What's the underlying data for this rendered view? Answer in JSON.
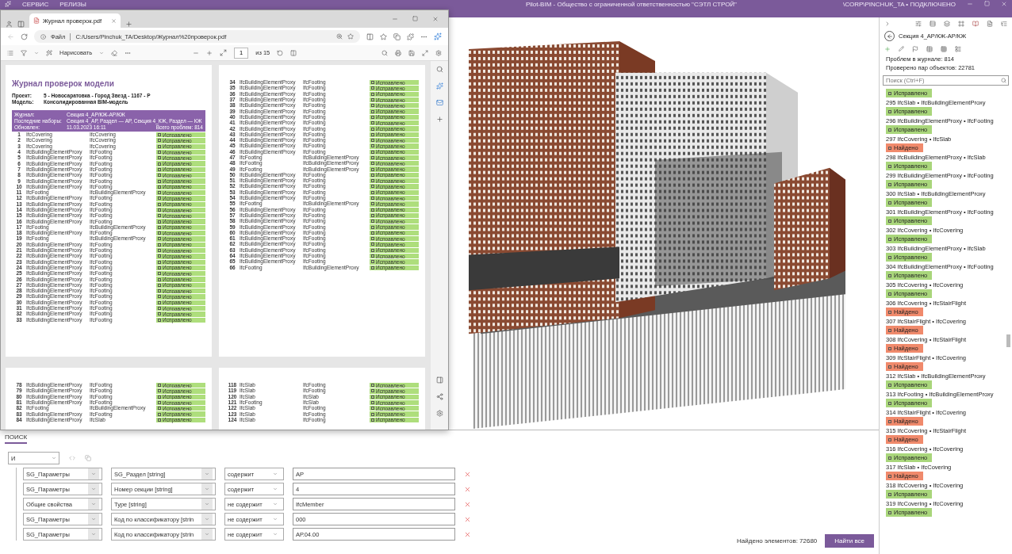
{
  "app": {
    "menu": [
      "СЕРВИС",
      "РЕЛИЗЫ"
    ],
    "title": "Pilot-BIM - Общество с ограниченной ответственностью \"СЭТЛ СТРОЙ\"",
    "user": "\\CORP\\PINCHUK_TA • ПОДКЛЮЧЕНО"
  },
  "browser": {
    "tab": {
      "title": "Журнал проверок.pdf",
      "selected": true
    },
    "address": {
      "scheme": "Файл",
      "url": "C:/Users/Pinchuk_TA/Desktop/Журнал%20проверок.pdf"
    },
    "toolbar": {
      "draw": "Нарисовать",
      "page": "1",
      "page_count": "из 15"
    },
    "pages": [
      {
        "header": {
          "title": "Журнал проверок модели",
          "meta": [
            [
              "Проект:",
              "5 - Новосаратовка - Город Звезд - 1167 - Р"
            ],
            [
              "Модель:",
              "Консолидированная BIM-модель"
            ]
          ],
          "journal": [
            [
              "Журнал:",
              "Секция 4_АР/КЖ-АР/КЖ"
            ],
            [
              "Последние наборы:",
              "Секция 4_АР, Раздел — АР, Секция 4_КЖ, Раздел — КЖ"
            ],
            [
              "Обновлен:",
              "11.03.2023 16:11",
              "Всего проблем: 814"
            ]
          ]
        },
        "rows": [
          [
            "1",
            "IfcCovering",
            "IfcCovering",
            "Исправлено"
          ],
          [
            "2",
            "IfcCovering",
            "IfcCovering",
            "Исправлено"
          ],
          [
            "3",
            "IfcCovering",
            "IfcCovering",
            "Исправлено"
          ],
          [
            "4",
            "IfcBuildingElementProxy",
            "IfcFooting",
            "Исправлено"
          ],
          [
            "5",
            "IfcBuildingElementProxy",
            "IfcFooting",
            "Исправлено"
          ],
          [
            "6",
            "IfcBuildingElementProxy",
            "IfcFooting",
            "Исправлено"
          ],
          [
            "7",
            "IfcBuildingElementProxy",
            "IfcFooting",
            "Исправлено"
          ],
          [
            "8",
            "IfcBuildingElementProxy",
            "IfcFooting",
            "Исправлено"
          ],
          [
            "9",
            "IfcBuildingElementProxy",
            "IfcFooting",
            "Исправлено"
          ],
          [
            "10",
            "IfcBuildingElementProxy",
            "IfcFooting",
            "Исправлено"
          ],
          [
            "11",
            "IfcFooting",
            "IfcBuildingElementProxy",
            "Исправлено"
          ],
          [
            "12",
            "IfcBuildingElementProxy",
            "IfcFooting",
            "Исправлено"
          ],
          [
            "13",
            "IfcBuildingElementProxy",
            "IfcFooting",
            "Исправлено"
          ],
          [
            "14",
            "IfcBuildingElementProxy",
            "IfcFooting",
            "Исправлено"
          ],
          [
            "15",
            "IfcBuildingElementProxy",
            "IfcFooting",
            "Исправлено"
          ],
          [
            "16",
            "IfcBuildingElementProxy",
            "IfcFooting",
            "Исправлено"
          ],
          [
            "17",
            "IfcFooting",
            "IfcBuildingElementProxy",
            "Исправлено"
          ],
          [
            "18",
            "IfcBuildingElementProxy",
            "IfcFooting",
            "Исправлено"
          ],
          [
            "19",
            "IfcFooting",
            "IfcBuildingElementProxy",
            "Исправлено"
          ],
          [
            "20",
            "IfcBuildingElementProxy",
            "IfcFooting",
            "Исправлено"
          ],
          [
            "21",
            "IfcBuildingElementProxy",
            "IfcFooting",
            "Исправлено"
          ],
          [
            "22",
            "IfcBuildingElementProxy",
            "IfcFooting",
            "Исправлено"
          ],
          [
            "23",
            "IfcBuildingElementProxy",
            "IfcFooting",
            "Исправлено"
          ],
          [
            "24",
            "IfcBuildingElementProxy",
            "IfcFooting",
            "Исправлено"
          ],
          [
            "25",
            "IfcBuildingElementProxy",
            "IfcFooting",
            "Исправлено"
          ],
          [
            "26",
            "IfcBuildingElementProxy",
            "IfcFooting",
            "Исправлено"
          ],
          [
            "27",
            "IfcBuildingElementProxy",
            "IfcFooting",
            "Исправлено"
          ],
          [
            "28",
            "IfcBuildingElementProxy",
            "IfcFooting",
            "Исправлено"
          ],
          [
            "29",
            "IfcBuildingElementProxy",
            "IfcFooting",
            "Исправлено"
          ],
          [
            "30",
            "IfcBuildingElementProxy",
            "IfcFooting",
            "Исправлено"
          ],
          [
            "31",
            "IfcBuildingElementProxy",
            "IfcFooting",
            "Исправлено"
          ],
          [
            "32",
            "IfcBuildingElementProxy",
            "IfcFooting",
            "Исправлено"
          ],
          [
            "33",
            "IfcBuildingElementProxy",
            "IfcFooting",
            "Исправлено"
          ]
        ]
      },
      {
        "rows": [
          [
            "34",
            "IfcBuildingElementProxy",
            "IfcFooting",
            "Исправлено"
          ],
          [
            "35",
            "IfcBuildingElementProxy",
            "IfcFooting",
            "Исправлено"
          ],
          [
            "36",
            "IfcBuildingElementProxy",
            "IfcFooting",
            "Исправлено"
          ],
          [
            "37",
            "IfcBuildingElementProxy",
            "IfcFooting",
            "Исправлено"
          ],
          [
            "38",
            "IfcBuildingElementProxy",
            "IfcFooting",
            "Исправлено"
          ],
          [
            "39",
            "IfcBuildingElementProxy",
            "IfcFooting",
            "Исправлено"
          ],
          [
            "40",
            "IfcBuildingElementProxy",
            "IfcFooting",
            "Исправлено"
          ],
          [
            "41",
            "IfcBuildingElementProxy",
            "IfcFooting",
            "Исправлено"
          ],
          [
            "42",
            "IfcBuildingElementProxy",
            "IfcFooting",
            "Исправлено"
          ],
          [
            "43",
            "IfcBuildingElementProxy",
            "IfcFooting",
            "Исправлено"
          ],
          [
            "44",
            "IfcBuildingElementProxy",
            "IfcFooting",
            "Исправлено"
          ],
          [
            "45",
            "IfcBuildingElementProxy",
            "IfcFooting",
            "Исправлено"
          ],
          [
            "46",
            "IfcBuildingElementProxy",
            "IfcFooting",
            "Исправлено"
          ],
          [
            "47",
            "IfcFooting",
            "IfcBuildingElementProxy",
            "Исправлено"
          ],
          [
            "48",
            "IfcFooting",
            "IfcBuildingElementProxy",
            "Исправлено"
          ],
          [
            "49",
            "IfcFooting",
            "IfcBuildingElementProxy",
            "Исправлено"
          ],
          [
            "50",
            "IfcBuildingElementProxy",
            "IfcFooting",
            "Исправлено"
          ],
          [
            "51",
            "IfcBuildingElementProxy",
            "IfcFooting",
            "Исправлено"
          ],
          [
            "52",
            "IfcBuildingElementProxy",
            "IfcFooting",
            "Исправлено"
          ],
          [
            "53",
            "IfcBuildingElementProxy",
            "IfcFooting",
            "Исправлено"
          ],
          [
            "54",
            "IfcBuildingElementProxy",
            "IfcFooting",
            "Исправлено"
          ],
          [
            "55",
            "IfcFooting",
            "IfcBuildingElementProxy",
            "Исправлено"
          ],
          [
            "56",
            "IfcBuildingElementProxy",
            "IfcFooting",
            "Исправлено"
          ],
          [
            "57",
            "IfcBuildingElementProxy",
            "IfcFooting",
            "Исправлено"
          ],
          [
            "58",
            "IfcBuildingElementProxy",
            "IfcFooting",
            "Исправлено"
          ],
          [
            "59",
            "IfcBuildingElementProxy",
            "IfcFooting",
            "Исправлено"
          ],
          [
            "60",
            "IfcBuildingElementProxy",
            "IfcFooting",
            "Исправлено"
          ],
          [
            "61",
            "IfcBuildingElementProxy",
            "IfcFooting",
            "Исправлено"
          ],
          [
            "62",
            "IfcBuildingElementProxy",
            "IfcFooting",
            "Исправлено"
          ],
          [
            "63",
            "IfcBuildingElementProxy",
            "IfcFooting",
            "Исправлено"
          ],
          [
            "64",
            "IfcBuildingElementProxy",
            "IfcFooting",
            "Исправлено"
          ],
          [
            "65",
            "IfcBuildingElementProxy",
            "IfcFooting",
            "Исправлено"
          ],
          [
            "66",
            "IfcFooting",
            "IfcBuildingElementProxy",
            "Исправлено"
          ]
        ]
      },
      {
        "rows": [
          [
            "78",
            "IfcBuildingElementProxy",
            "IfcFooting",
            "Исправлено"
          ],
          [
            "79",
            "IfcBuildingElementProxy",
            "IfcFooting",
            "Исправлено"
          ],
          [
            "80",
            "IfcBuildingElementProxy",
            "IfcFooting",
            "Исправлено"
          ],
          [
            "81",
            "IfcBuildingElementProxy",
            "IfcFooting",
            "Исправлено"
          ],
          [
            "82",
            "IfcFooting",
            "IfcBuildingElementProxy",
            "Исправлено"
          ],
          [
            "83",
            "IfcBuildingElementProxy",
            "IfcFooting",
            "Исправлено"
          ],
          [
            "84",
            "IfcBuildingElementProxy",
            "IfcSlab",
            "Исправлено"
          ]
        ]
      },
      {
        "rows": [
          [
            "118",
            "IfcSlab",
            "IfcFooting",
            "Исправлено"
          ],
          [
            "119",
            "IfcSlab",
            "IfcFooting",
            "Исправлено"
          ],
          [
            "120",
            "IfcSlab",
            "IfcSlab",
            "Исправлено"
          ],
          [
            "121",
            "IfcFooting",
            "IfcSlab",
            "Исправлено"
          ],
          [
            "122",
            "IfcSlab",
            "IfcFooting",
            "Исправлено"
          ],
          [
            "123",
            "IfcSlab",
            "IfcFooting",
            "Исправлено"
          ],
          [
            "124",
            "IfcSlab",
            "IfcFooting",
            "Исправлено"
          ]
        ]
      }
    ]
  },
  "journal_panel": {
    "section_title": "Секция 4_АР/КЖ-АР/КЖ",
    "stats": [
      "Проблем в журнале: 814",
      "Проверено пар объектов: 22781"
    ],
    "search": {
      "placeholder": "Поиск (Ctrl+F)"
    },
    "issues": [
      {
        "status": "Исправлено",
        "kind": "fixed"
      },
      {
        "number": "295",
        "title": "IfcSlab • IfcBuildingElementProxy",
        "status": "Исправлено",
        "kind": "fixed"
      },
      {
        "number": "296",
        "title": "IfcBuildingElementProxy • IfcFooting",
        "status": "Исправлено",
        "kind": "fixed"
      },
      {
        "number": "297",
        "title": "IfcCovering • IfcSlab",
        "status": "Найдено",
        "kind": "found"
      },
      {
        "number": "298",
        "title": "IfcBuildingElementProxy • IfcSlab",
        "status": "Исправлено",
        "kind": "fixed"
      },
      {
        "number": "299",
        "title": "IfcBuildingElementProxy • IfcFooting",
        "status": "Исправлено",
        "kind": "fixed"
      },
      {
        "number": "300",
        "title": "IfcSlab • IfcBuildingElementProxy",
        "status": "Исправлено",
        "kind": "fixed"
      },
      {
        "number": "301",
        "title": "IfcBuildingElementProxy • IfcFooting",
        "status": "Исправлено",
        "kind": "fixed"
      },
      {
        "number": "302",
        "title": "IfcCovering • IfcCovering",
        "status": "Исправлено",
        "kind": "fixed"
      },
      {
        "number": "303",
        "title": "IfcBuildingElementProxy • IfcSlab",
        "status": "Исправлено",
        "kind": "fixed"
      },
      {
        "number": "304",
        "title": "IfcBuildingElementProxy • IfcFooting",
        "status": "Исправлено",
        "kind": "fixed"
      },
      {
        "number": "305",
        "title": "IfcCovering • IfcCovering",
        "status": "Исправлено",
        "kind": "fixed"
      },
      {
        "number": "306",
        "title": "IfcCovering • IfcStairFlight",
        "status": "Найдено",
        "kind": "found"
      },
      {
        "number": "307",
        "title": "IfcStairFlight • IfcCovering",
        "status": "Найдено",
        "kind": "found"
      },
      {
        "number": "308",
        "title": "IfcCovering • IfcStairFlight",
        "status": "Найдено",
        "kind": "found"
      },
      {
        "number": "309",
        "title": "IfcStairFlight • IfcCovering",
        "status": "Найдено",
        "kind": "found"
      },
      {
        "number": "312",
        "title": "IfcSlab • IfcBuildingElementProxy",
        "status": "Исправлено",
        "kind": "fixed"
      },
      {
        "number": "313",
        "title": "IfcFooting • IfcBuildingElementProxy",
        "status": "Исправлено",
        "kind": "fixed"
      },
      {
        "number": "314",
        "title": "IfcStairFlight • IfcCovering",
        "status": "Найдено",
        "kind": "found"
      },
      {
        "number": "315",
        "title": "IfcCovering • IfcStairFlight",
        "status": "Найдено",
        "kind": "found"
      },
      {
        "number": "316",
        "title": "IfcCovering • IfcCovering",
        "status": "Исправлено",
        "kind": "fixed"
      },
      {
        "number": "317",
        "title": "IfcSlab • IfcCovering",
        "status": "Найдено",
        "kind": "found"
      },
      {
        "number": "318",
        "title": "IfcCovering • IfcCovering",
        "status": "Исправлено",
        "kind": "fixed"
      },
      {
        "number": "319",
        "title": "IfcCovering • IfcCovering",
        "status": "Исправлено",
        "kind": "fixed"
      }
    ]
  },
  "search_panel": {
    "tab": {
      "label": "ПОИСК",
      "selected": true
    },
    "logic": "И",
    "filters": [
      {
        "group": "SG_Параметры",
        "parameter": "SG_Раздел [string]",
        "operator": "содержит",
        "value": "АР"
      },
      {
        "group": "SG_Параметры",
        "parameter": "Номер секции [string]",
        "operator": "содержит",
        "value": "4"
      },
      {
        "group": "Общие свойства",
        "parameter": "Type [string]",
        "operator": "не содержит",
        "value": "IfcMember"
      },
      {
        "group": "SG_Параметры",
        "parameter": "Код по классификатору [strin",
        "operator": "не содержит",
        "value": "000"
      },
      {
        "group": "SG_Параметры",
        "parameter": "Код по классификатору [strin",
        "operator": "не содержит",
        "value": "АР.04.00"
      }
    ],
    "found": "Найдено элементов: 72680",
    "button": "Найти все"
  }
}
